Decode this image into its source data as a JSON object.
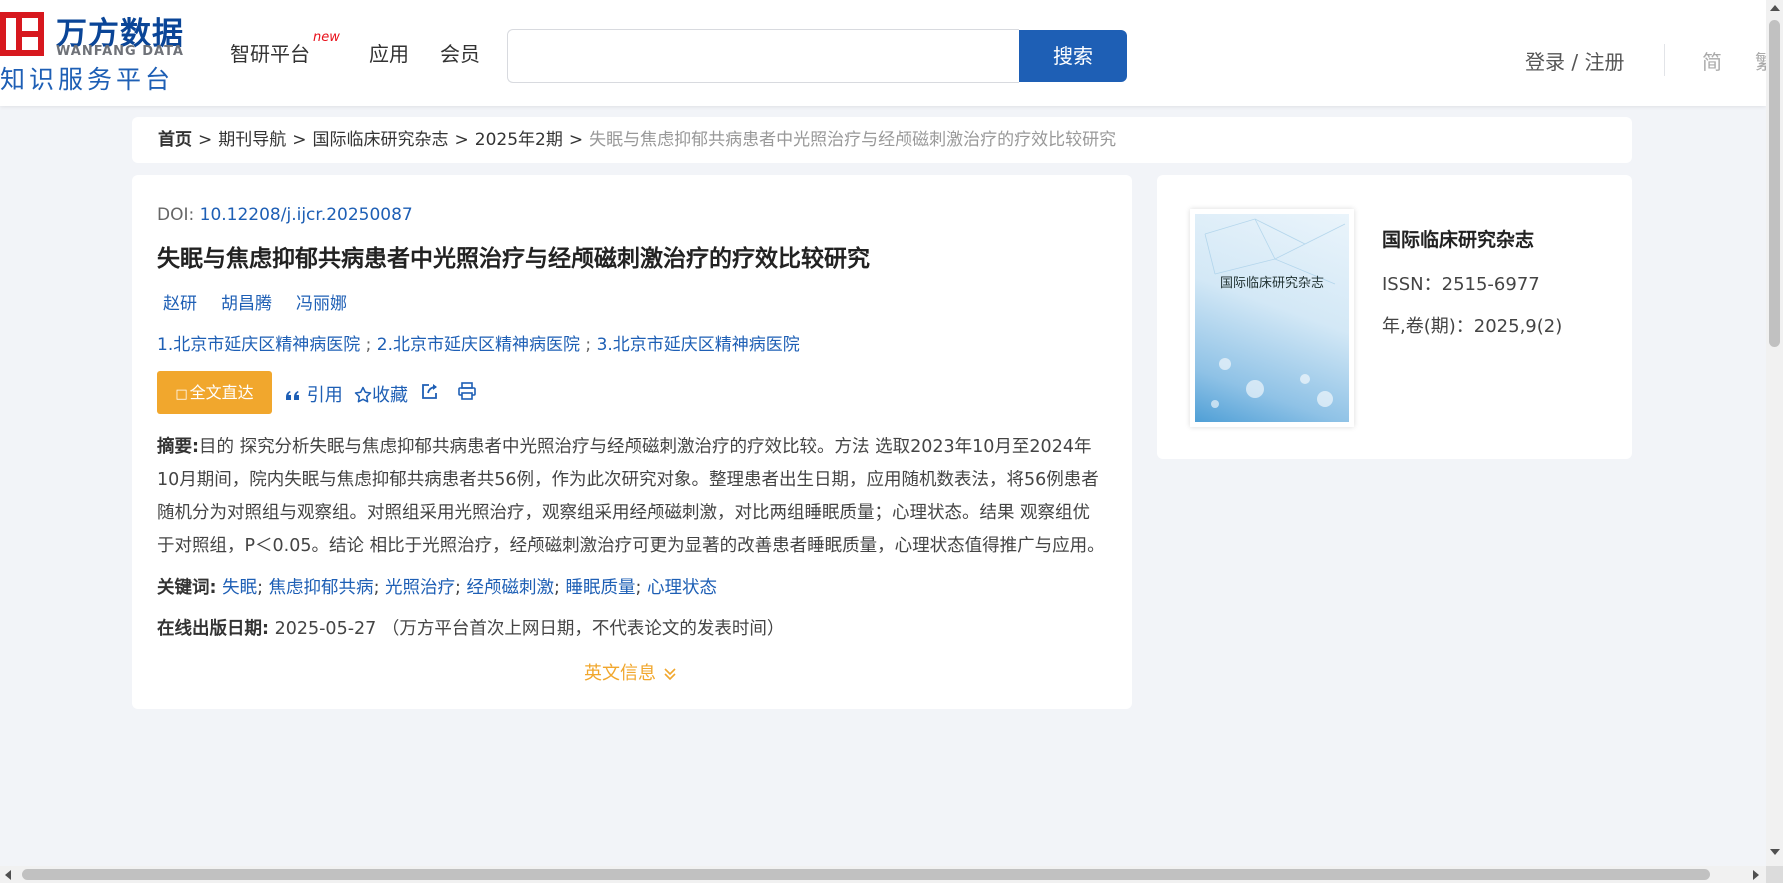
{
  "header": {
    "logo_cn": "万方数据",
    "logo_en": "WANFANG DATA",
    "logo_sub": "知识服务平台",
    "nav": [
      {
        "label": "智研平台",
        "badge": "new"
      },
      {
        "label": "应用"
      },
      {
        "label": "会员"
      }
    ],
    "search": {
      "value": "",
      "placeholder": "",
      "button": "搜索"
    },
    "login": "登录 / 注册",
    "lang_simplified": "简",
    "lang_traditional": "繁"
  },
  "breadcrumb": {
    "home": "首页",
    "items": [
      "期刊导航",
      "国际临床研究杂志",
      "2025年2期"
    ],
    "current": "失眠与焦虑抑郁共病患者中光照治疗与经颅磁刺激治疗的疗效比较研究",
    "separator": ">"
  },
  "article": {
    "doi_label": "DOI:",
    "doi": "10.12208/j.ijcr.20250087",
    "title": "失眠与焦虑抑郁共病患者中光照治疗与经颅磁刺激治疗的疗效比较研究",
    "authors": [
      "赵研",
      "胡昌腾",
      "冯丽娜"
    ],
    "orgs": [
      "1.北京市延庆区精神病医院",
      "2.北京市延庆区精神病医院",
      "3.北京市延庆区精神病医院"
    ],
    "org_separator": ";",
    "actions": {
      "fulltext": "全文直达",
      "cite": "引用",
      "collect": "收藏"
    },
    "abstract_label": "摘要:",
    "abstract": "目的 探究分析失眠与焦虑抑郁共病患者中光照治疗与经颅磁刺激治疗的疗效比较。方法 选取2023年10月至2024年10月期间，院内失眠与焦虑抑郁共病患者共56例，作为此次研究对象。整理患者出生日期，应用随机数表法，将56例患者随机分为对照组与观察组。对照组采用光照治疗，观察组采用经颅磁刺激，对比两组睡眠质量；心理状态。结果 观察组优于对照组，P＜0.05。结论 相比于光照治疗，经颅磁刺激治疗可更为显著的改善患者睡眠质量，心理状态值得推广与应用。",
    "keywords_label": "关键词:",
    "keywords": [
      "失眠",
      "焦虑抑郁共病",
      "光照治疗",
      "经颅磁刺激",
      "睡眠质量",
      "心理状态"
    ],
    "keyword_separator": ";",
    "pubdate_label": "在线出版日期:",
    "pubdate": "2025-05-27",
    "pubdate_note": "（万方平台首次上网日期，不代表论文的发表时间）",
    "en_info": "英文信息"
  },
  "journal": {
    "cover_title": "国际临床研究杂志",
    "name": "国际临床研究杂志",
    "issn": "ISSN：2515-6977",
    "volume": "年,卷(期)：2025,9(2)"
  },
  "colors": {
    "brand_blue": "#1e5fb5",
    "brand_red": "#d7181e",
    "accent_orange": "#f1a72d",
    "background": "#f2f4f8"
  },
  "icons": {
    "cite": "quote-icon",
    "collect": "star-icon",
    "share": "share-icon",
    "print": "print-icon",
    "expand": "double-chevron-down-icon"
  }
}
